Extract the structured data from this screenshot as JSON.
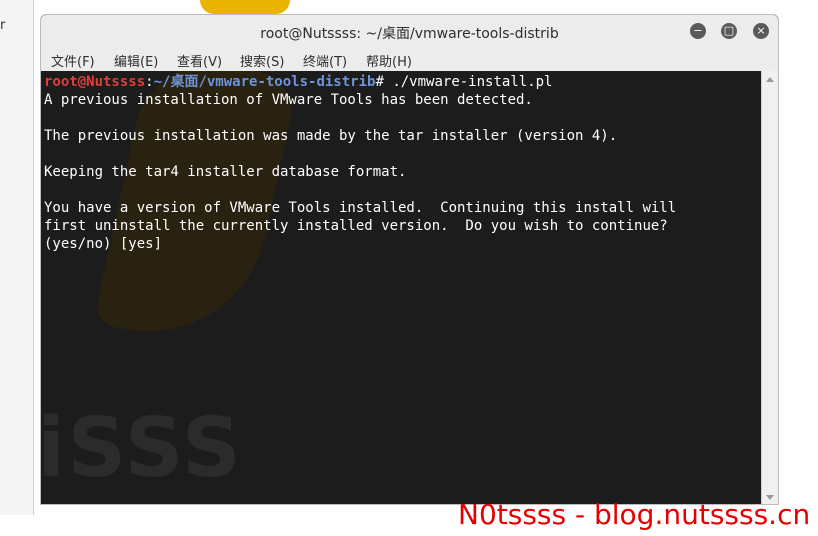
{
  "window": {
    "title": "root@Nutssss: ~/桌面/vmware-tools-distrib",
    "buttons": {
      "minimize": "−",
      "maximize": "□",
      "close": "×"
    }
  },
  "menu": [
    "文件(F)",
    "编辑(E)",
    "查看(V)",
    "搜索(S)",
    "终端(T)",
    "帮助(H)"
  ],
  "terminal": {
    "prompt_user": "root@Nutssss",
    "prompt_sep": ":",
    "prompt_path": "~/桌面/vmware-tools-distrib",
    "prompt_symbol": "# ",
    "command": "./vmware-install.pl",
    "output": [
      "A previous installation of VMware Tools has been detected.",
      "",
      "The previous installation was made by the tar installer (version 4).",
      "",
      "Keeping the tar4 installer database format.",
      "",
      "You have a version of VMware Tools installed.  Continuing this install will",
      "first uninstall the currently installed version.  Do you wish to continue?",
      "(yes/no) [yes]"
    ],
    "background_mark": "iSSS"
  },
  "desktop": {
    "edge_text": "r"
  },
  "watermark": "N0tssss - blog.nutssss.cn",
  "colors": {
    "terminal_bg": "#1c1c1c",
    "prompt_user": "#e23d3d",
    "prompt_path": "#6f93d8",
    "watermark": "#e60000"
  }
}
